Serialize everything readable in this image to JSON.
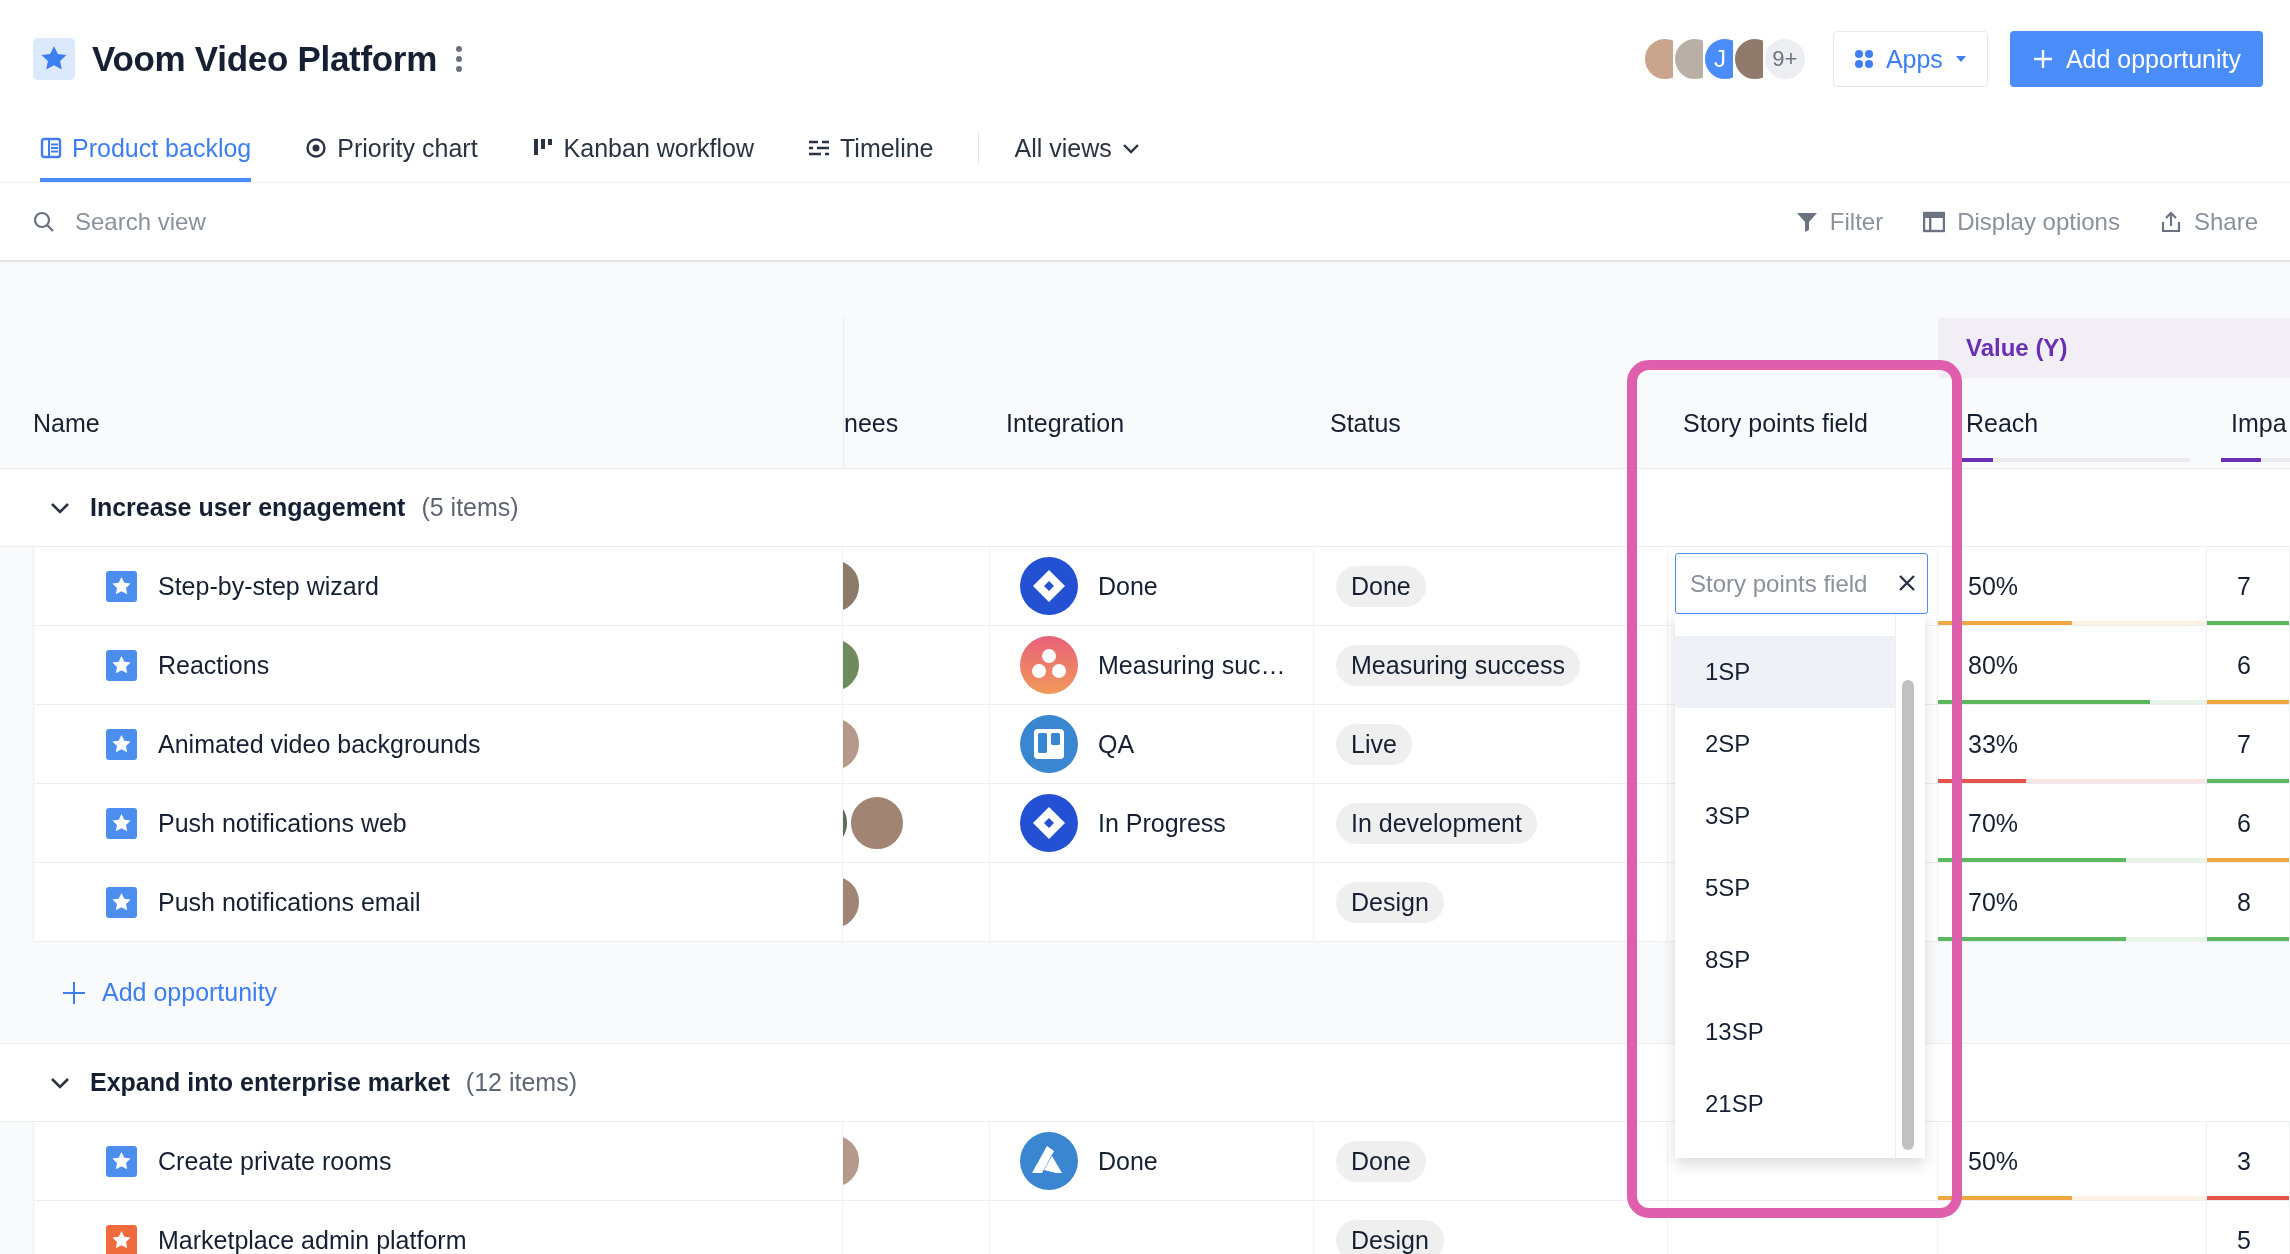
{
  "header": {
    "title": "Voom Video Platform",
    "avatars": [
      {
        "kind": "photo"
      },
      {
        "kind": "photo"
      },
      {
        "kind": "initial",
        "text": "J"
      },
      {
        "kind": "photo"
      }
    ],
    "more": "9+",
    "apps": "Apps",
    "add": "Add opportunity"
  },
  "tabs": [
    {
      "label": "Product backlog",
      "kind": "list",
      "selected": true
    },
    {
      "label": "Priority chart",
      "kind": "target",
      "selected": false
    },
    {
      "label": "Kanban workflow",
      "kind": "kanban",
      "selected": false
    },
    {
      "label": "Timeline",
      "kind": "timeline",
      "selected": false
    }
  ],
  "all_views": "All views",
  "toolbar": {
    "search_placeholder": "Search view",
    "actions": [
      {
        "label": "Filter",
        "kind": "filter"
      },
      {
        "label": "Display options",
        "kind": "layout"
      },
      {
        "label": "Share",
        "kind": "share"
      }
    ]
  },
  "table": {
    "column_group": "Value (Y)",
    "columns": [
      {
        "label": "Name"
      },
      {
        "label": "nees"
      },
      {
        "label": "Integration"
      },
      {
        "label": "Status"
      },
      {
        "label": "Story points field"
      },
      {
        "label": "Reach",
        "level": 0.17
      },
      {
        "label": "Impa",
        "level": 0.17
      }
    ],
    "groups": [
      {
        "title": "Increase user engagement",
        "count": "(5 items)",
        "expanded": true,
        "add_label": "Add opportunity",
        "rows": [
          {
            "name": "Step-by-step wizard",
            "color": "#4b8ef0",
            "assignees": [
              {
                "kind": "photo"
              }
            ],
            "integration": {
              "kind": "jira",
              "label": "Done"
            },
            "status": "Done",
            "reach": {
              "text": "50%",
              "level": 0.5,
              "color": "#f0a742"
            },
            "impact": {
              "text": "7",
              "color": "#5cb85c"
            }
          },
          {
            "name": "Reactions",
            "color": "#4b8ef0",
            "assignees": [
              {
                "kind": "photo"
              }
            ],
            "integration": {
              "kind": "asana",
              "label": "Measuring suc…"
            },
            "status": "Measuring success",
            "reach": {
              "text": "80%",
              "level": 0.79,
              "color": "#5cb85c"
            },
            "impact": {
              "text": "6",
              "color": "#f0a742"
            }
          },
          {
            "name": "Animated video backgrounds",
            "color": "#4b8ef0",
            "assignees": [
              {
                "kind": "photo"
              }
            ],
            "integration": {
              "kind": "trello",
              "label": "QA"
            },
            "status": "Live",
            "reach": {
              "text": "33%",
              "level": 0.33,
              "color": "#e5534b"
            },
            "impact": {
              "text": "7",
              "color": "#5cb85c"
            }
          },
          {
            "name": "Push notifications web",
            "color": "#4b8ef0",
            "assignees": [
              {
                "kind": "photo"
              },
              {
                "kind": "photo"
              }
            ],
            "integration": {
              "kind": "jira",
              "label": "In Progress"
            },
            "status": "In development",
            "reach": {
              "text": "70%",
              "level": 0.7,
              "color": "#5cb85c"
            },
            "impact": {
              "text": "6",
              "color": "#f0a742"
            }
          },
          {
            "name": "Push notifications email",
            "color": "#4b8ef0",
            "assignees": [
              {
                "kind": "photo"
              }
            ],
            "status": "Design",
            "reach": {
              "text": "70%",
              "level": 0.7,
              "color": "#5cb85c"
            },
            "impact": {
              "text": "8",
              "color": "#5cb85c"
            }
          }
        ]
      },
      {
        "title": "Expand into enterprise market",
        "count": "(12 items)",
        "expanded": true,
        "rows": [
          {
            "name": "Create private rooms",
            "color": "#4b8ef0",
            "assignees": [
              {
                "kind": "photo"
              }
            ],
            "integration": {
              "kind": "azure",
              "label": "Done"
            },
            "status": "Done",
            "reach": {
              "text": "50%",
              "level": 0.5,
              "color": "#f0a742"
            },
            "impact": {
              "text": "3",
              "color": "#e5534b"
            }
          },
          {
            "name": "Marketplace admin platform",
            "color": "#ef6a3c",
            "status": "Design",
            "impact": {
              "text": "5"
            }
          }
        ]
      }
    ]
  },
  "story_points_dropdown": {
    "placeholder": "Story points field",
    "options": [
      {
        "label": "1SP",
        "selected": true
      },
      {
        "label": "2SP",
        "selected": false
      },
      {
        "label": "3SP",
        "selected": false
      },
      {
        "label": "5SP",
        "selected": false
      },
      {
        "label": "8SP",
        "selected": false
      },
      {
        "label": "13SP",
        "selected": false
      },
      {
        "label": "21SP",
        "selected": false
      }
    ]
  }
}
